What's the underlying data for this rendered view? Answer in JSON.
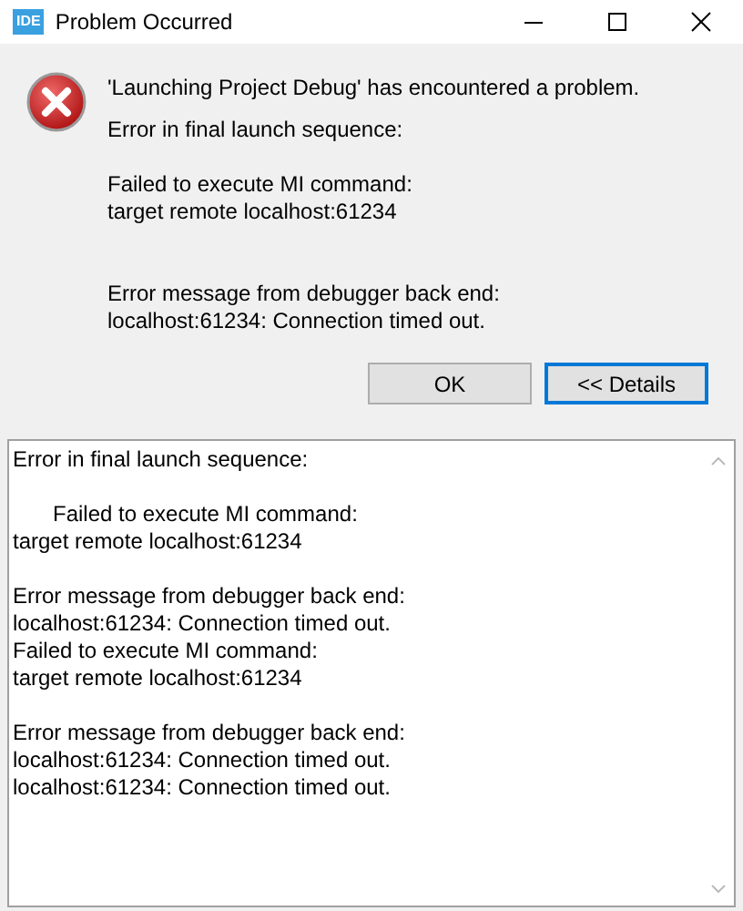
{
  "window": {
    "app_badge": "IDE",
    "title": "Problem Occurred"
  },
  "message": {
    "heading": "'Launching Project Debug' has encountered a problem.",
    "paragraphs": [
      [
        "Error in final launch sequence:"
      ],
      [
        "Failed to execute MI command:",
        "target remote localhost:61234"
      ],
      [
        "Error message from debugger back end:",
        "localhost:61234: Connection timed out."
      ]
    ]
  },
  "buttons": [
    {
      "label": "OK",
      "focused": false
    },
    {
      "label": "<< Details",
      "focused": true
    }
  ],
  "details": {
    "blocks": [
      [
        "Error in final launch sequence:"
      ],
      [
        "\tFailed to execute MI command:",
        "target remote localhost:61234"
      ],
      [
        "Error message from debugger back end:",
        "localhost:61234: Connection timed out.",
        "Failed to execute MI command:",
        "target remote localhost:61234"
      ],
      [
        "Error message from debugger back end:",
        "localhost:61234: Connection timed out.",
        "localhost:61234: Connection timed out."
      ]
    ]
  }
}
